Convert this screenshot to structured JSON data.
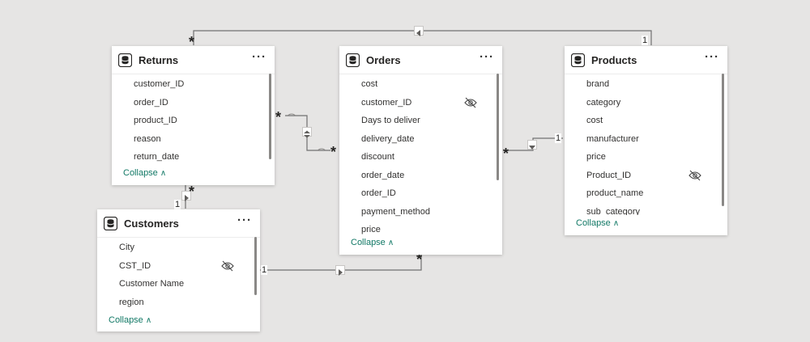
{
  "tables": {
    "returns": {
      "title": "Returns",
      "more": "···",
      "fields": [
        "customer_ID",
        "order_ID",
        "product_ID",
        "reason",
        "return_date"
      ],
      "collapse": "Collapse"
    },
    "orders": {
      "title": "Orders",
      "more": "···",
      "fields": [
        "cost",
        "customer_ID",
        "Days to deliver",
        "delivery_date",
        "discount",
        "order_date",
        "order_ID",
        "payment_method",
        "price"
      ],
      "collapse": "Collapse"
    },
    "products": {
      "title": "Products",
      "more": "···",
      "fields": [
        "brand",
        "category",
        "cost",
        "manufacturer",
        "price",
        "Product_ID",
        "product_name",
        "sub_category"
      ],
      "collapse": "Collapse"
    },
    "customers": {
      "title": "Customers",
      "more": "···",
      "fields": [
        "City",
        "CST_ID",
        "Customer Name",
        "region"
      ],
      "collapse": "Collapse"
    }
  },
  "cardinality": {
    "many": "*",
    "one": "1"
  },
  "icons": {
    "table": "table-icon",
    "hidden": "eye-hidden-icon",
    "collapse_chevron": "chevron-up-icon",
    "filter_arrow": "filter-direction-icon"
  },
  "colors": {
    "canvas": "#e6e5e4",
    "collapse_link": "#117865",
    "line": "#6e6e6e"
  }
}
